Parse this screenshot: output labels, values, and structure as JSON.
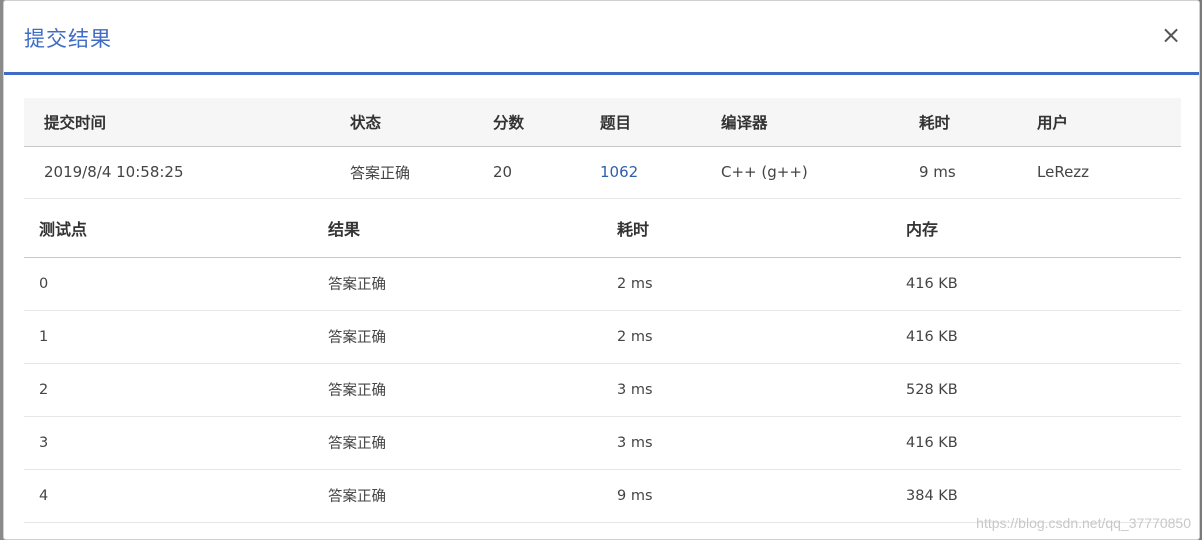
{
  "dialog": {
    "title": "提交结果",
    "close_label": "×"
  },
  "summary": {
    "headers": [
      "提交时间",
      "状态",
      "分数",
      "题目",
      "编译器",
      "耗时",
      "用户"
    ],
    "row": {
      "time": "2019/8/4 10:58:25",
      "status": "答案正确",
      "score": "20",
      "problem": "1062",
      "compiler": "C++ (g++)",
      "elapsed": "9 ms",
      "user": "LeRezz"
    }
  },
  "testcases": {
    "headers": [
      "测试点",
      "结果",
      "耗时",
      "内存"
    ],
    "rows": [
      {
        "id": "0",
        "result": "答案正确",
        "time": "2 ms",
        "memory": "416 KB"
      },
      {
        "id": "1",
        "result": "答案正确",
        "time": "2 ms",
        "memory": "416 KB"
      },
      {
        "id": "2",
        "result": "答案正确",
        "time": "3 ms",
        "memory": "528 KB"
      },
      {
        "id": "3",
        "result": "答案正确",
        "time": "3 ms",
        "memory": "416 KB"
      },
      {
        "id": "4",
        "result": "答案正确",
        "time": "9 ms",
        "memory": "384 KB"
      }
    ]
  },
  "watermark": "https://blog.csdn.net/qq_37770850",
  "colors": {
    "accent": "#3f6dc6",
    "status_ok": "#e03b3b",
    "link": "#2e5faa"
  }
}
